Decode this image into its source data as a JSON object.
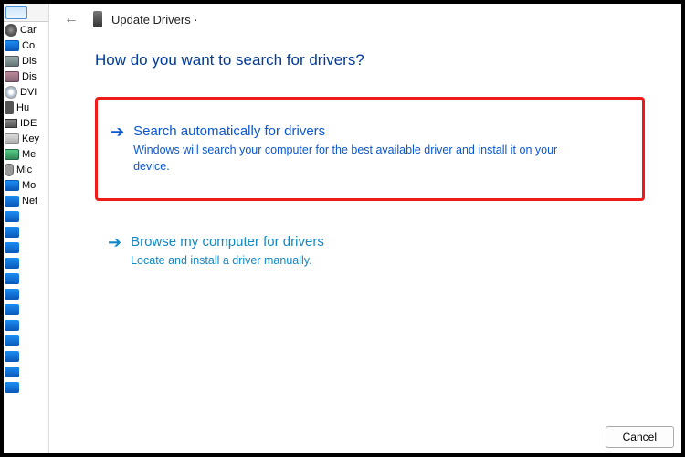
{
  "dialog": {
    "title": "Update Drivers ·",
    "heading": "How do you want to search for drivers?",
    "option1": {
      "title": "Search automatically for drivers",
      "desc": "Windows will search your computer for the best available driver and install it on your device."
    },
    "option2": {
      "title": "Browse my computer for drivers",
      "desc": "Locate and install a driver manually."
    },
    "cancel": "Cancel"
  },
  "sidebar": {
    "items": [
      "Car",
      "Co",
      "Dis",
      "Dis",
      "DVI",
      "Hu",
      "IDE",
      "Key",
      "Me",
      "Mic",
      "Mo",
      "Net"
    ]
  }
}
